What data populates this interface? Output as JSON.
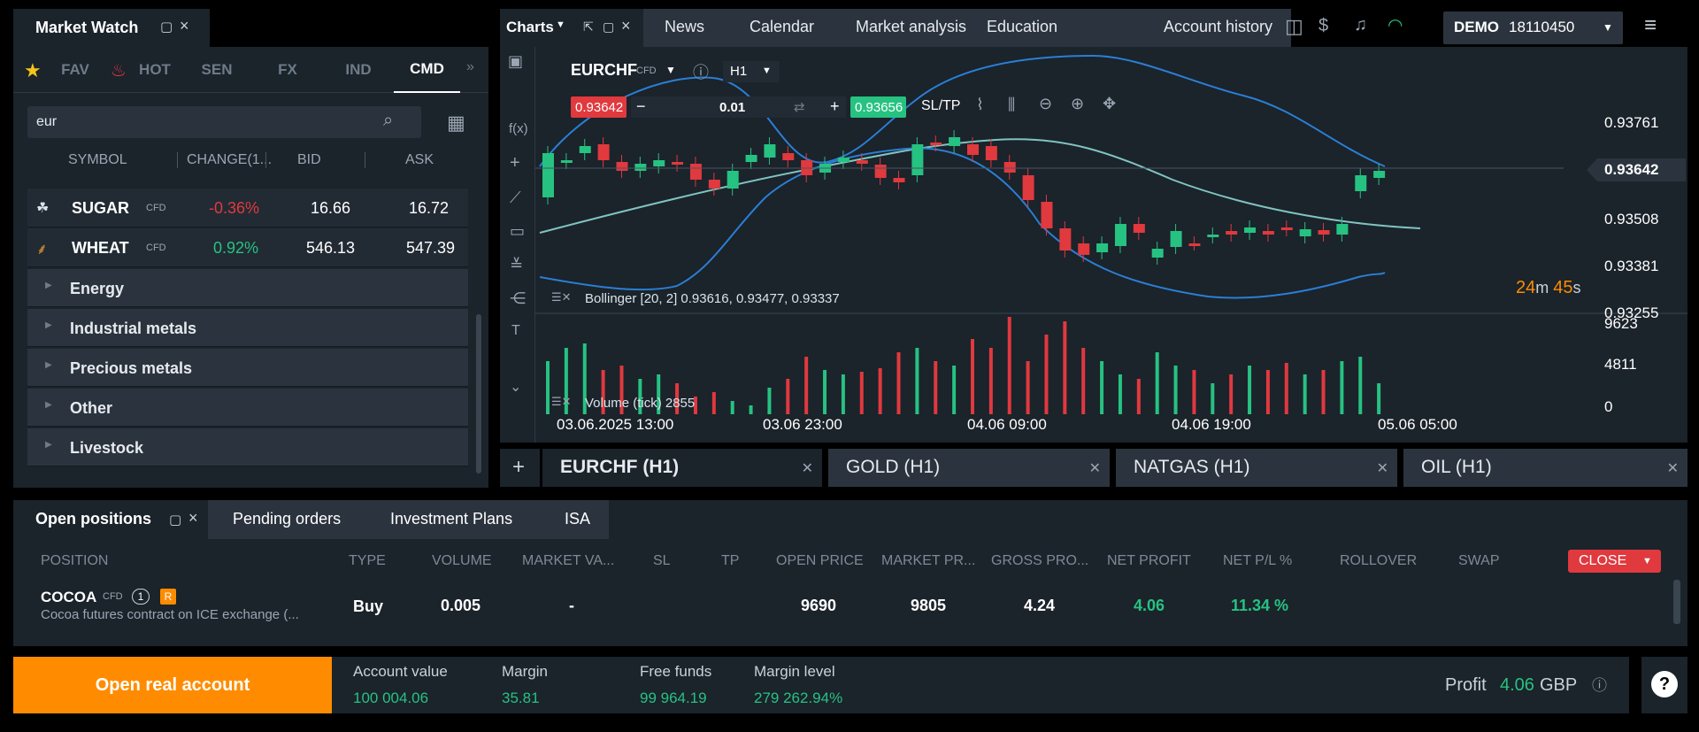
{
  "market_watch": {
    "title": "Market Watch",
    "tabs": [
      "FAV",
      "HOT",
      "SEN",
      "FX",
      "IND",
      "CMD"
    ],
    "search_value": "eur",
    "columns": [
      "SYMBOL",
      "CHANGE(1...",
      "BID",
      "ASK"
    ],
    "rows": [
      {
        "symbol": "SUGAR",
        "tag": "CFD",
        "change": "-0.36%",
        "bid": "16.66",
        "ask": "16.72"
      },
      {
        "symbol": "WHEAT",
        "tag": "CFD",
        "change": "0.92%",
        "bid": "546.13",
        "ask": "547.39"
      }
    ],
    "groups": [
      "Energy",
      "Industrial metals",
      "Precious metals",
      "Other",
      "Livestock"
    ]
  },
  "nav": {
    "charts": "Charts",
    "items": [
      "News",
      "Calendar",
      "Market analysis",
      "Education",
      "Account history"
    ],
    "account_mode": "DEMO",
    "account_id": "18110450"
  },
  "chart": {
    "symbol": "EURCHF",
    "tag": "CFD",
    "timeframe": "H1",
    "sell_price": "0.93642",
    "volume": "0.01",
    "buy_price": "0.93656",
    "sltp": "SL/TP",
    "indicator": "Bollinger [20, 2] 0.93616, 0.93477, 0.93337",
    "volume_label": "Volume (tick) 2855",
    "countdown_m": "24",
    "countdown_s": "45",
    "price_ticks": [
      "0.93761",
      "0.93642",
      "0.93508",
      "0.93381",
      "0.93255"
    ],
    "vol_ticks": [
      "9623",
      "4811",
      "0"
    ],
    "time_ticks": [
      "03.06.2025 13:00",
      "03.06 23:00",
      "04.06 09:00",
      "04.06 19:00",
      "05.06 05:00"
    ]
  },
  "chart_tabs": [
    "EURCHF (H1)",
    "GOLD (H1)",
    "NATGAS (H1)",
    "OIL (H1)"
  ],
  "positions": {
    "tabs": [
      "Open positions",
      "Pending orders",
      "Investment Plans",
      "ISA"
    ],
    "columns": [
      "POSITION",
      "TYPE",
      "VOLUME",
      "MARKET VA...",
      "SL",
      "TP",
      "OPEN PRICE",
      "MARKET PR...",
      "GROSS PRO...",
      "NET PROFIT",
      "NET P/L %",
      "ROLLOVER",
      "SWAP"
    ],
    "close_label": "CLOSE",
    "row": {
      "symbol": "COCOA",
      "tag": "CFD",
      "count": "1",
      "badge": "R",
      "desc": "Cocoa futures contract on ICE exchange (...",
      "type": "Buy",
      "volume": "0.005",
      "market_value": "-",
      "open_price": "9690",
      "market_price": "9805",
      "gross": "4.24",
      "net": "4.06",
      "netpct": "11.34 %"
    }
  },
  "footer": {
    "open_real": "Open real account",
    "account_value_label": "Account value",
    "account_value": "100 004.06",
    "margin_label": "Margin",
    "margin": "35.81",
    "free_label": "Free funds",
    "free": "99 964.19",
    "level_label": "Margin level",
    "level": "279 262.94%",
    "profit_label": "Profit",
    "profit": "4.06",
    "currency": "GBP"
  },
  "colors": {
    "up": "#26c281",
    "down": "#e0393e",
    "accent": "#ff8c00",
    "band": "#2a7fd4",
    "mid": "#7fc4c0"
  }
}
